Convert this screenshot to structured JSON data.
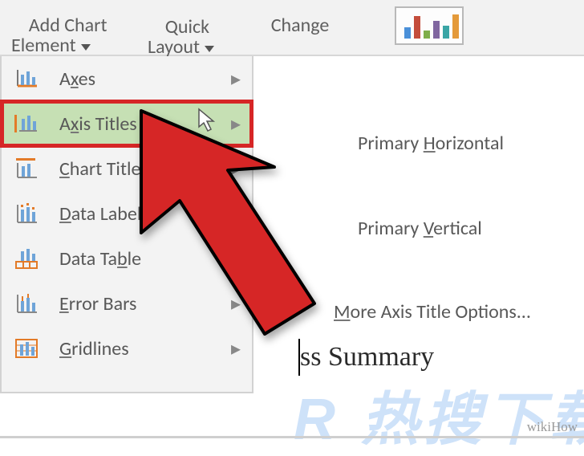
{
  "ribbon": {
    "add_chart_element": "Add Chart\nElement",
    "quick_layout": "Quick\nLayout",
    "change": "Change"
  },
  "menu": {
    "items": [
      {
        "label": "Axes",
        "mn_index": 1
      },
      {
        "label": "Axis Titles",
        "mn_index": 1
      },
      {
        "label": "Chart Title",
        "mn_index": 0
      },
      {
        "label": "Data Labels",
        "mn_index": 0
      },
      {
        "label": "Data Table",
        "mn_index": 7
      },
      {
        "label": "Error Bars",
        "mn_index": 0
      },
      {
        "label": "Gridlines",
        "mn_index": 0
      }
    ]
  },
  "submenu": {
    "primary_h": "Primary Horizontal",
    "primary_v": "Primary Vertical",
    "more": "More Axis Title Options..."
  },
  "document": {
    "visible_title_fragment": "ss Summary"
  },
  "watermarks": {
    "resou": "R 热搜下载",
    "wikihow": "wikiHow"
  }
}
